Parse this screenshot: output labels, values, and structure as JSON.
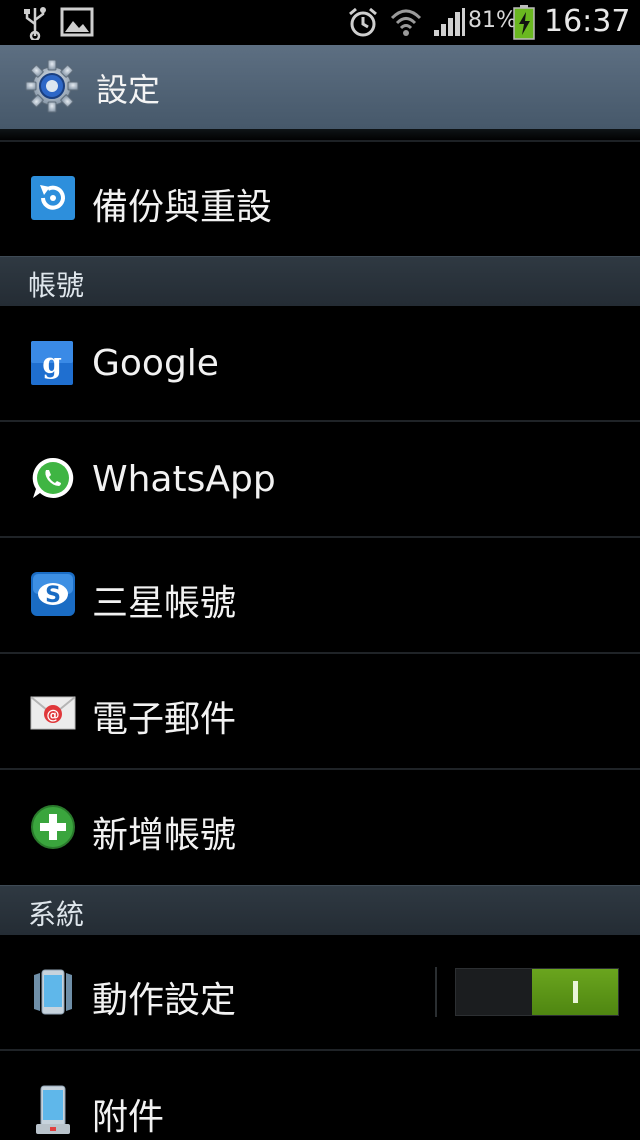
{
  "status_bar": {
    "battery_percent": "81%",
    "time": "16:37",
    "icons": [
      "usb-icon",
      "image-icon",
      "alarm-icon",
      "wifi-icon",
      "signal-icon",
      "battery-charging-icon"
    ]
  },
  "header": {
    "title": "設定",
    "icon": "settings-gear-icon"
  },
  "items_top": [
    {
      "label": "備份與重設",
      "icon": "backup-reset-icon"
    }
  ],
  "sections": {
    "accounts": {
      "title": "帳號",
      "items": [
        {
          "label": "Google",
          "icon": "google-icon"
        },
        {
          "label": "WhatsApp",
          "icon": "whatsapp-icon"
        },
        {
          "label": "三星帳號",
          "icon": "samsung-account-icon"
        },
        {
          "label": "電子郵件",
          "icon": "email-icon"
        },
        {
          "label": "新增帳號",
          "icon": "add-account-icon"
        }
      ]
    },
    "system": {
      "title": "系統",
      "items": [
        {
          "label": "動作設定",
          "icon": "motion-icon",
          "toggle": true
        },
        {
          "label": "附件",
          "icon": "accessory-icon"
        }
      ]
    }
  },
  "colors": {
    "action_bar": "#50637a",
    "section_header": "#2a333c",
    "toggle_on": "#5c9518"
  }
}
